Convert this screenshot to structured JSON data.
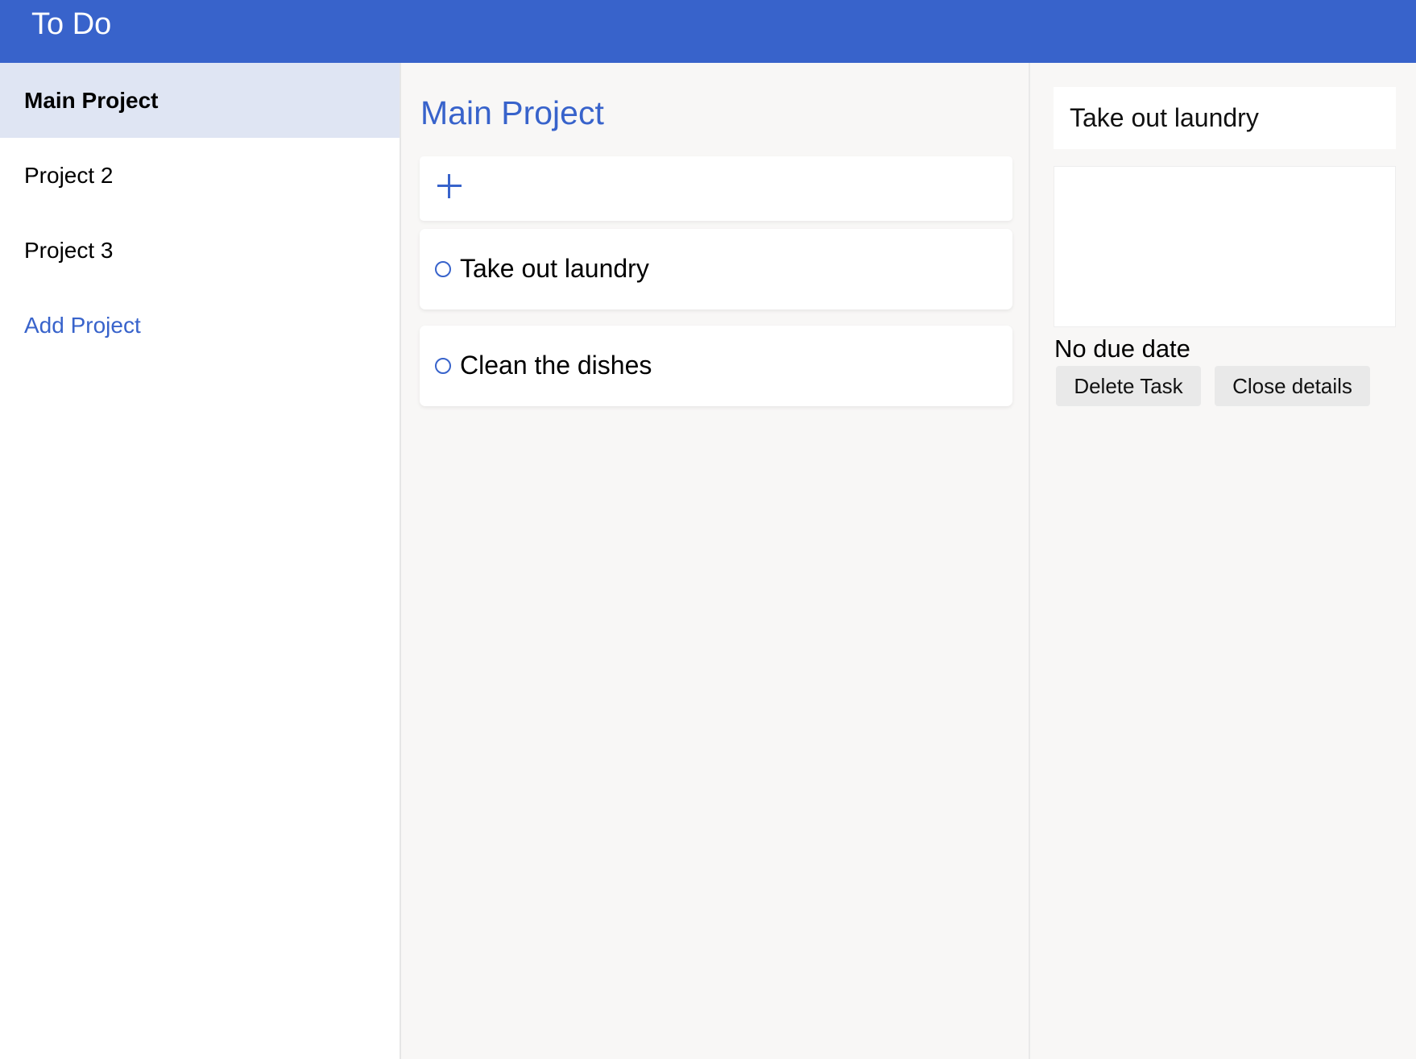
{
  "header": {
    "title": "To Do",
    "color": "#3863cb"
  },
  "sidebar": {
    "items": [
      {
        "label": "Main Project",
        "active": true
      },
      {
        "label": "Project 2",
        "active": false
      },
      {
        "label": "Project 3",
        "active": false
      }
    ],
    "add_label": "Add Project"
  },
  "main": {
    "heading": "Main Project",
    "add_icon": "plus-icon",
    "tasks": [
      {
        "title": "Take out laundry",
        "icon": "circle-icon"
      },
      {
        "title": "Clean the dishes",
        "icon": "circle-icon"
      }
    ]
  },
  "details": {
    "title_value": "Take out laundry",
    "notes_value": "",
    "due_date": "No due date",
    "delete_label": "Delete Task",
    "close_label": "Close details"
  }
}
